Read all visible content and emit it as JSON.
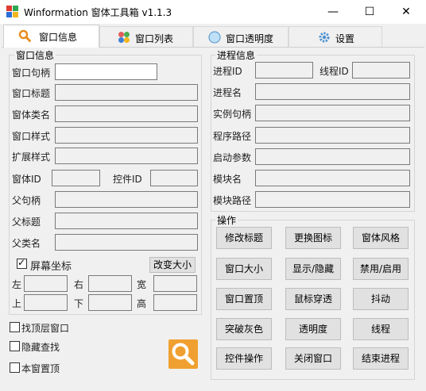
{
  "window": {
    "title": "Winformation 窗体工具箱 v1.1.3",
    "minimize_glyph": "—",
    "maximize_glyph": "☐",
    "close_glyph": "✕"
  },
  "tabs": [
    {
      "label": "窗口信息",
      "icon": "magnifier-icon",
      "active": true
    },
    {
      "label": "窗口列表",
      "icon": "window-list-icon",
      "active": false
    },
    {
      "label": "窗口透明度",
      "icon": "opacity-circle-icon",
      "active": false
    },
    {
      "label": "设置",
      "icon": "gear-icon",
      "active": false
    }
  ],
  "window_info": {
    "group_title": "窗口信息",
    "handle_label": "窗口句柄",
    "title_label": "窗口标题",
    "class_label": "窗体类名",
    "style_label": "窗口样式",
    "exstyle_label": "扩展样式",
    "form_id_label": "窗体ID",
    "control_id_label": "控件ID",
    "parent_handle_label": "父句柄",
    "parent_title_label": "父标题",
    "parent_class_label": "父类名",
    "screen_coords_label": "屏幕坐标",
    "screen_coords_checked": true,
    "resize_button": "改变大小",
    "left_label": "左",
    "right_label": "右",
    "width_label": "宽",
    "top_label": "上",
    "bottom_label": "下",
    "height_label": "高"
  },
  "process_info": {
    "group_title": "进程信息",
    "pid_label": "进程ID",
    "tid_label": "线程ID",
    "name_label": "进程名",
    "instance_label": "实例句柄",
    "path_label": "程序路径",
    "args_label": "启动参数",
    "module_label": "模块名",
    "module_path_label": "模块路径"
  },
  "operations": {
    "group_title": "操作",
    "buttons": [
      [
        "修改标题",
        "更换图标",
        "窗体风格"
      ],
      [
        "窗口大小",
        "显示/隐藏",
        "禁用/启用"
      ],
      [
        "窗口置顶",
        "鼠标穿透",
        "抖动"
      ],
      [
        "突破灰色",
        "透明度",
        "线程"
      ],
      [
        "控件操作",
        "关闭窗口",
        "结束进程"
      ]
    ]
  },
  "options": {
    "find_top": "找顶层窗口",
    "hidden_search": "隐藏查找",
    "topmost": "本窗置顶"
  },
  "colors": {
    "search_button_bg": "#f0a030",
    "search_icon_color": "#ffffff",
    "tab_icon_orange": "#e88a1a"
  }
}
